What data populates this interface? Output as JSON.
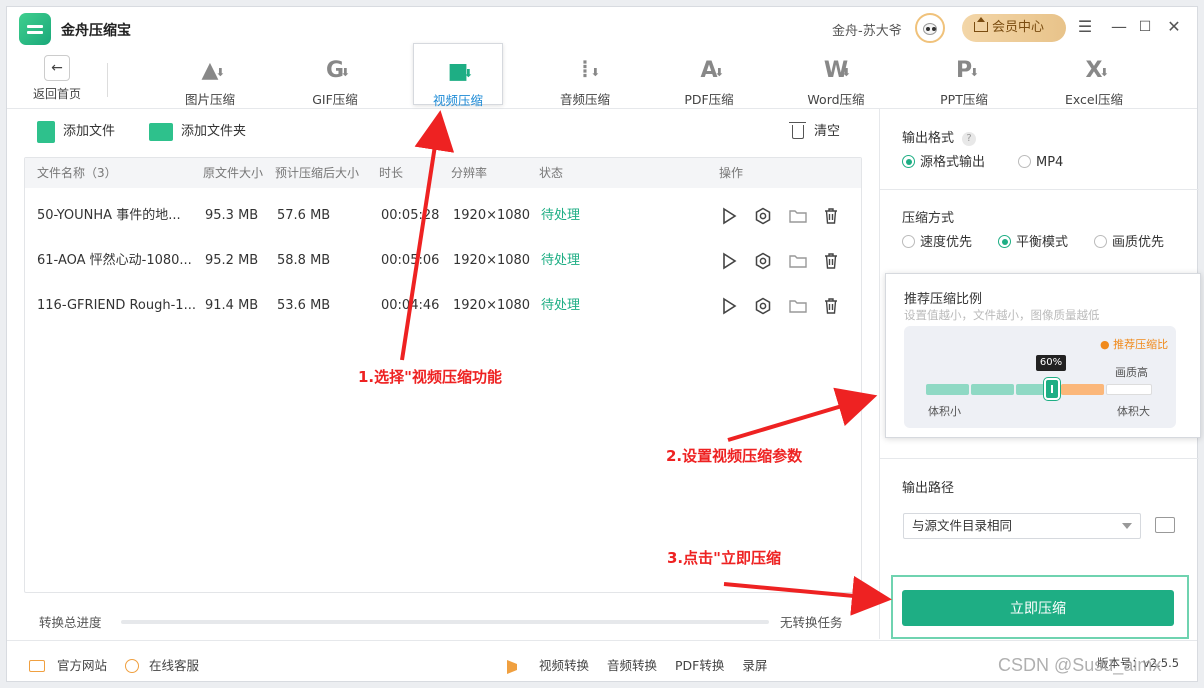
{
  "app": {
    "title": "金舟压缩宝",
    "user_name": "金舟-苏大爷",
    "vip_label": "会员中心"
  },
  "toolbar": {
    "back_label": "返回首页",
    "tools": [
      {
        "label": "图片压缩",
        "icon": "image-compress-icon",
        "glyph": "▲"
      },
      {
        "label": "GIF压缩",
        "icon": "gif-compress-icon",
        "glyph": "G"
      },
      {
        "label": "视频压缩",
        "icon": "video-compress-icon",
        "glyph": "■",
        "active": true
      },
      {
        "label": "音频压缩",
        "icon": "audio-compress-icon",
        "glyph": "⦙"
      },
      {
        "label": "PDF压缩",
        "icon": "pdf-compress-icon",
        "glyph": "A"
      },
      {
        "label": "Word压缩",
        "icon": "word-compress-icon",
        "glyph": "W"
      },
      {
        "label": "PPT压缩",
        "icon": "ppt-compress-icon",
        "glyph": "P"
      },
      {
        "label": "Excel压缩",
        "icon": "excel-compress-icon",
        "glyph": "X"
      }
    ]
  },
  "actions": {
    "add_file": "添加文件",
    "add_folder": "添加文件夹",
    "clear": "清空"
  },
  "table": {
    "headers": [
      "文件名称（3）",
      "原文件大小",
      "预计压缩后大小",
      "时长",
      "分辨率",
      "状态",
      "操作"
    ],
    "rows": [
      {
        "name": "50-YOUNHA 事件的地...",
        "size": "95.3 MB",
        "est": "57.6 MB",
        "duration": "00:05:28",
        "resolution": "1920×1080",
        "status": "待处理"
      },
      {
        "name": "61-AOA 怦然心动-1080...",
        "size": "95.2 MB",
        "est": "58.8 MB",
        "duration": "00:05:06",
        "resolution": "1920×1080",
        "status": "待处理"
      },
      {
        "name": "116-GFRIEND Rough-1...",
        "size": "91.4 MB",
        "est": "53.6 MB",
        "duration": "00:04:46",
        "resolution": "1920×1080",
        "status": "待处理"
      }
    ]
  },
  "progress": {
    "label": "转换总进度",
    "value": 0,
    "status": "无转换任务"
  },
  "settings": {
    "output_format": {
      "label": "输出格式",
      "help": "?",
      "options": [
        "源格式输出",
        "MP4"
      ],
      "selected": 0
    },
    "compress_mode": {
      "label": "压缩方式",
      "options": [
        "速度优先",
        "平衡模式",
        "画质优先"
      ],
      "selected": 1
    },
    "ratio": {
      "title": "推荐压缩比例",
      "subtitle": "设置值越小，文件越小，图像质量越低",
      "recommended": "● 推荐压缩比",
      "quality_high": "画质高",
      "value": 60,
      "value_label": "60%",
      "min_label": "体积小",
      "max_label": "体积大"
    },
    "output_path": {
      "label": "输出路径",
      "value": "与源文件目录相同"
    },
    "start_button": "立即压缩"
  },
  "bottom": {
    "website": "官方网站",
    "support": "在线客服",
    "links": [
      "视频转换",
      "音频转换",
      "PDF转换",
      "录屏"
    ],
    "version": "版本号：v2.5.5"
  },
  "annotations": {
    "step1": "1.选择\"视频压缩功能",
    "step2": "2.设置视频压缩参数",
    "step3": "3.点击\"立即压缩",
    "color": "#ee2222"
  },
  "watermark": "CSDN @Susu_aimx",
  "colors": {
    "accent": "#1eae84",
    "vip": "#e8c38a",
    "recommend": "#f08a1c"
  }
}
